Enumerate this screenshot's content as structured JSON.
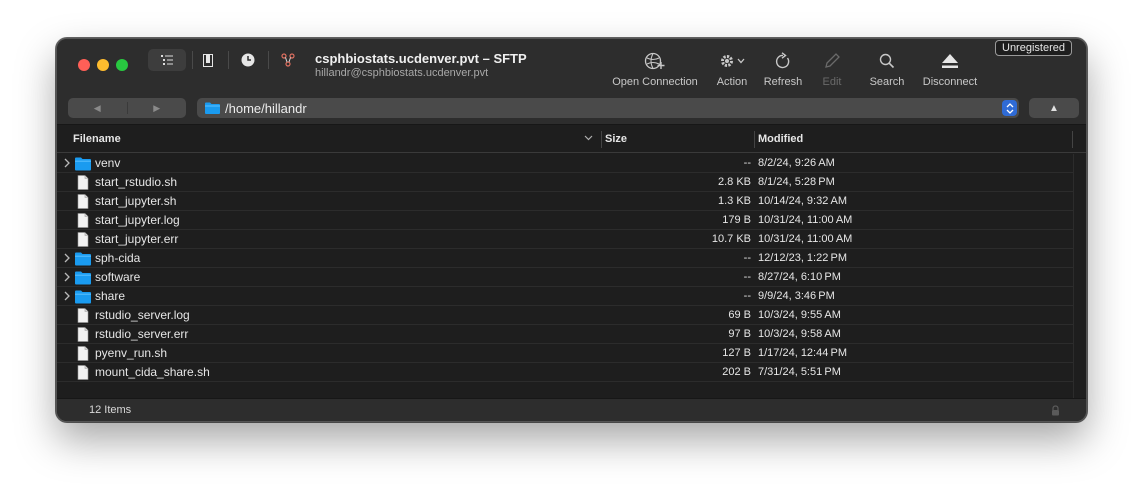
{
  "window": {
    "title": "csphbiostats.ucdenver.pvt – SFTP",
    "subtitle": "hillandr@csphbiostats.ucdenver.pvt",
    "badge": "Unregistered"
  },
  "toolbar": {
    "open_connection": "Open Connection",
    "action": "Action",
    "refresh": "Refresh",
    "edit": "Edit",
    "search": "Search",
    "disconnect": "Disconnect"
  },
  "navigation": {
    "back_glyph": "◀",
    "forward_glyph": "▶",
    "path": "/home/hillandr",
    "up_glyph": "▲"
  },
  "table": {
    "columns": {
      "filename": "Filename",
      "size": "Size",
      "modified": "Modified"
    },
    "rows": [
      {
        "name": "venv",
        "size": "--",
        "modified": "8/2/24, 9:26 AM",
        "type": "folder"
      },
      {
        "name": "start_rstudio.sh",
        "size": "2.8 KB",
        "modified": "8/1/24, 5:28 PM",
        "type": "file"
      },
      {
        "name": "start_jupyter.sh",
        "size": "1.3 KB",
        "modified": "10/14/24, 9:32 AM",
        "type": "file"
      },
      {
        "name": "start_jupyter.log",
        "size": "179 B",
        "modified": "10/31/24, 11:00 AM",
        "type": "file"
      },
      {
        "name": "start_jupyter.err",
        "size": "10.7 KB",
        "modified": "10/31/24, 11:00 AM",
        "type": "file"
      },
      {
        "name": "sph-cida",
        "size": "--",
        "modified": "12/12/23, 1:22 PM",
        "type": "folder"
      },
      {
        "name": "software",
        "size": "--",
        "modified": "8/27/24, 6:10 PM",
        "type": "folder"
      },
      {
        "name": "share",
        "size": "--",
        "modified": "9/9/24, 3:46 PM",
        "type": "folder"
      },
      {
        "name": "rstudio_server.log",
        "size": "69 B",
        "modified": "10/3/24, 9:55 AM",
        "type": "file"
      },
      {
        "name": "rstudio_server.err",
        "size": "97 B",
        "modified": "10/3/24, 9:58 AM",
        "type": "file"
      },
      {
        "name": "pyenv_run.sh",
        "size": "127 B",
        "modified": "1/17/24, 12:44 PM",
        "type": "file"
      },
      {
        "name": "mount_cida_share.sh",
        "size": "202 B",
        "modified": "7/31/24, 5:51 PM",
        "type": "file"
      }
    ]
  },
  "status": {
    "items": "12 Items"
  },
  "icons": {
    "folder_color": "#1a9bf0",
    "accent": "#2f6bd6"
  }
}
